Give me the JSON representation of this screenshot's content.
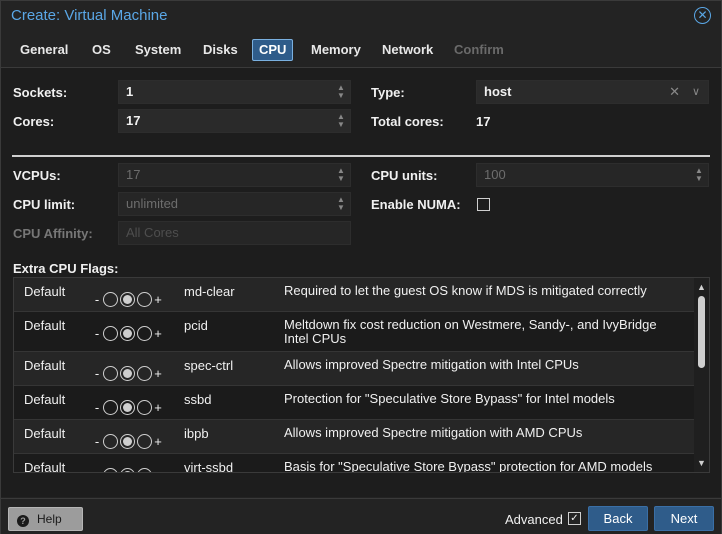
{
  "window": {
    "title": "Create: Virtual Machine"
  },
  "tabs": [
    {
      "label": "General",
      "state": "normal"
    },
    {
      "label": "OS",
      "state": "normal"
    },
    {
      "label": "System",
      "state": "normal"
    },
    {
      "label": "Disks",
      "state": "normal"
    },
    {
      "label": "CPU",
      "state": "active"
    },
    {
      "label": "Memory",
      "state": "normal"
    },
    {
      "label": "Network",
      "state": "normal"
    },
    {
      "label": "Confirm",
      "state": "disabled"
    }
  ],
  "cpu": {
    "sockets_label": "Sockets:",
    "sockets_value": "1",
    "cores_label": "Cores:",
    "cores_value": "17",
    "type_label": "Type:",
    "type_value": "host",
    "total_cores_label": "Total cores:",
    "total_cores_value": "17",
    "vcpus_label": "VCPUs:",
    "vcpus_value": "17",
    "cpu_units_label": "CPU units:",
    "cpu_units_value": "100",
    "cpu_limit_label": "CPU limit:",
    "cpu_limit_value": "unlimited",
    "numa_label": "Enable NUMA:",
    "numa_checked": false,
    "affinity_label": "CPU Affinity:",
    "affinity_value": "All Cores",
    "extra_flags_label": "Extra CPU Flags:"
  },
  "flags": [
    {
      "state": "Default",
      "name": "md-clear",
      "description": "Required to let the guest OS know if MDS is mitigated correctly",
      "minus": "-",
      "plus": "+"
    },
    {
      "state": "Default",
      "name": "pcid",
      "description": "Meltdown fix cost reduction on Westmere, Sandy-, and IvyBridge Intel CPUs",
      "minus": "-",
      "plus": "+"
    },
    {
      "state": "Default",
      "name": "spec-ctrl",
      "description": "Allows improved Spectre mitigation with Intel CPUs",
      "minus": "-",
      "plus": "+"
    },
    {
      "state": "Default",
      "name": "ssbd",
      "description": "Protection for \"Speculative Store Bypass\" for Intel models",
      "minus": "-",
      "plus": "+"
    },
    {
      "state": "Default",
      "name": "ibpb",
      "description": "Allows improved Spectre mitigation with AMD CPUs",
      "minus": "-",
      "plus": "+"
    },
    {
      "state": "Default",
      "name": "virt-ssbd",
      "description": "Basis for \"Speculative Store Bypass\" protection for AMD models",
      "minus": "-",
      "plus": "+"
    }
  ],
  "footer": {
    "help_label": "Help",
    "advanced_label": "Advanced",
    "advanced_checked": true,
    "back_label": "Back",
    "next_label": "Next"
  },
  "colors": {
    "accent": "#5aa7e6",
    "primary_button": "#2f5c8a",
    "background": "#1d1d1d"
  }
}
